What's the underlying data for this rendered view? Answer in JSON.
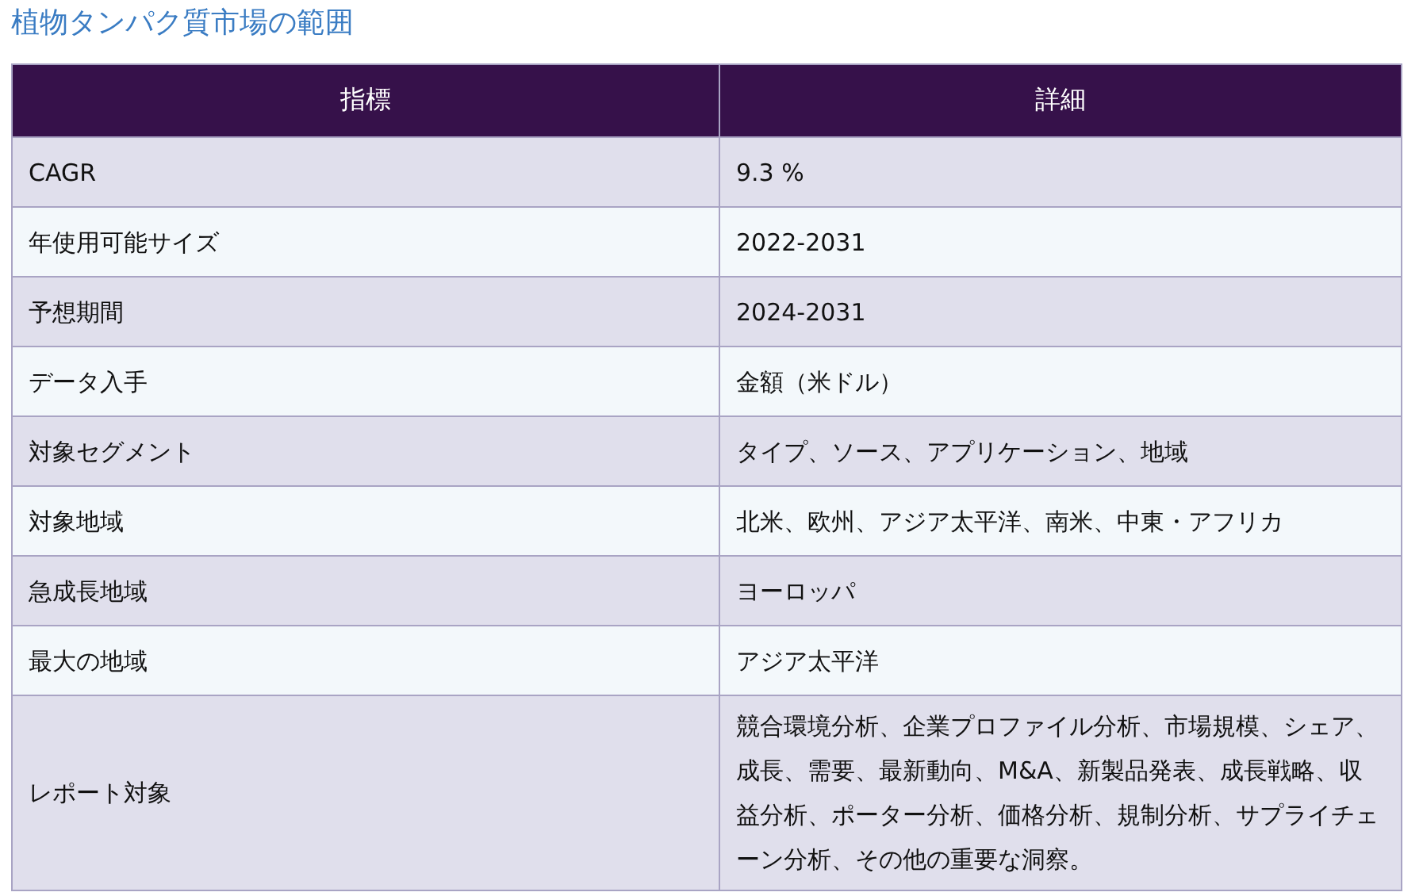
{
  "title": "植物タンパク質市場の範囲",
  "table": {
    "columns": [
      "指標",
      "詳細"
    ],
    "rows": [
      [
        "CAGR",
        "9.3 %"
      ],
      [
        "年使用可能サイズ",
        "2022-2031"
      ],
      [
        "予想期間",
        "2024-2031"
      ],
      [
        "データ入手",
        "金額（米ドル）"
      ],
      [
        "対象セグメント",
        "タイプ、ソース、アプリケーション、地域"
      ],
      [
        "対象地域",
        "北米、欧州、アジア太平洋、南米、中東・アフリカ"
      ],
      [
        "急成長地域",
        "ヨーロッパ"
      ],
      [
        "最大の地域",
        "アジア太平洋"
      ],
      [
        "レポート対象",
        "競合環境分析、企業プロファイル分析、市場規模、シェア、成長、需要、最新動向、M&A、新製品発表、成長戦略、収益分析、ポーター分析、価格分析、規制分析、サプライチェーン分析、その他の重要な洞察。"
      ]
    ]
  }
}
